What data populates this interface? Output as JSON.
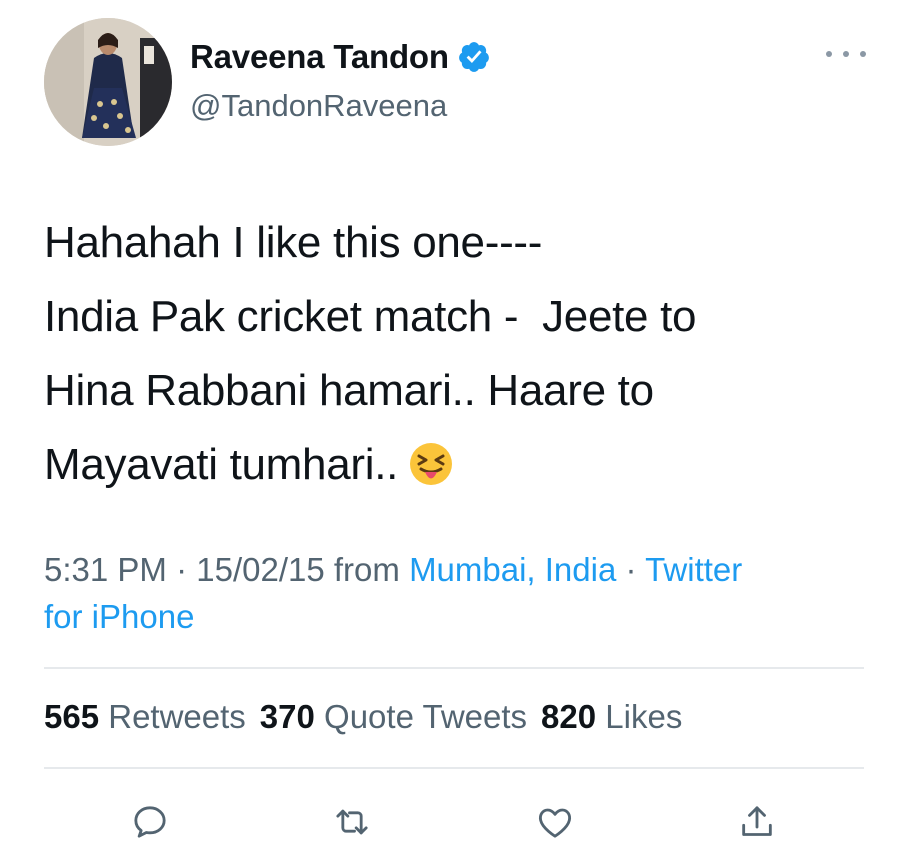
{
  "user": {
    "display_name": "Raveena Tandon",
    "handle": "@TandonRaveena",
    "verified_icon": "verified-badge-icon",
    "verified_color": "#1d9bf0"
  },
  "tweet": {
    "lines": [
      "Hahahah I like this one----",
      "India Pak cricket match -  Jeete to",
      "Hina Rabbani hamari.. Haare to",
      "Mayavati tumhari.."
    ],
    "emoji": "squinting-face-with-tongue-icon"
  },
  "meta": {
    "time": "5:31 PM",
    "separator": "·",
    "date": "15/02/15",
    "from": "from",
    "location": "Mumbai, India",
    "source_part1": "Twitter",
    "source_part2": "for iPhone",
    "link_color": "#1d9bf0"
  },
  "stats": {
    "retweets_count": "565",
    "retweets_label": "Retweets",
    "quotes_count": "370",
    "quotes_label": "Quote Tweets",
    "likes_count": "820",
    "likes_label": "Likes"
  },
  "actions": [
    "reply-icon",
    "retweet-icon",
    "like-icon",
    "share-icon"
  ],
  "colors": {
    "text": "#0f1419",
    "secondary": "#536471",
    "divider": "#e6e9ec"
  }
}
